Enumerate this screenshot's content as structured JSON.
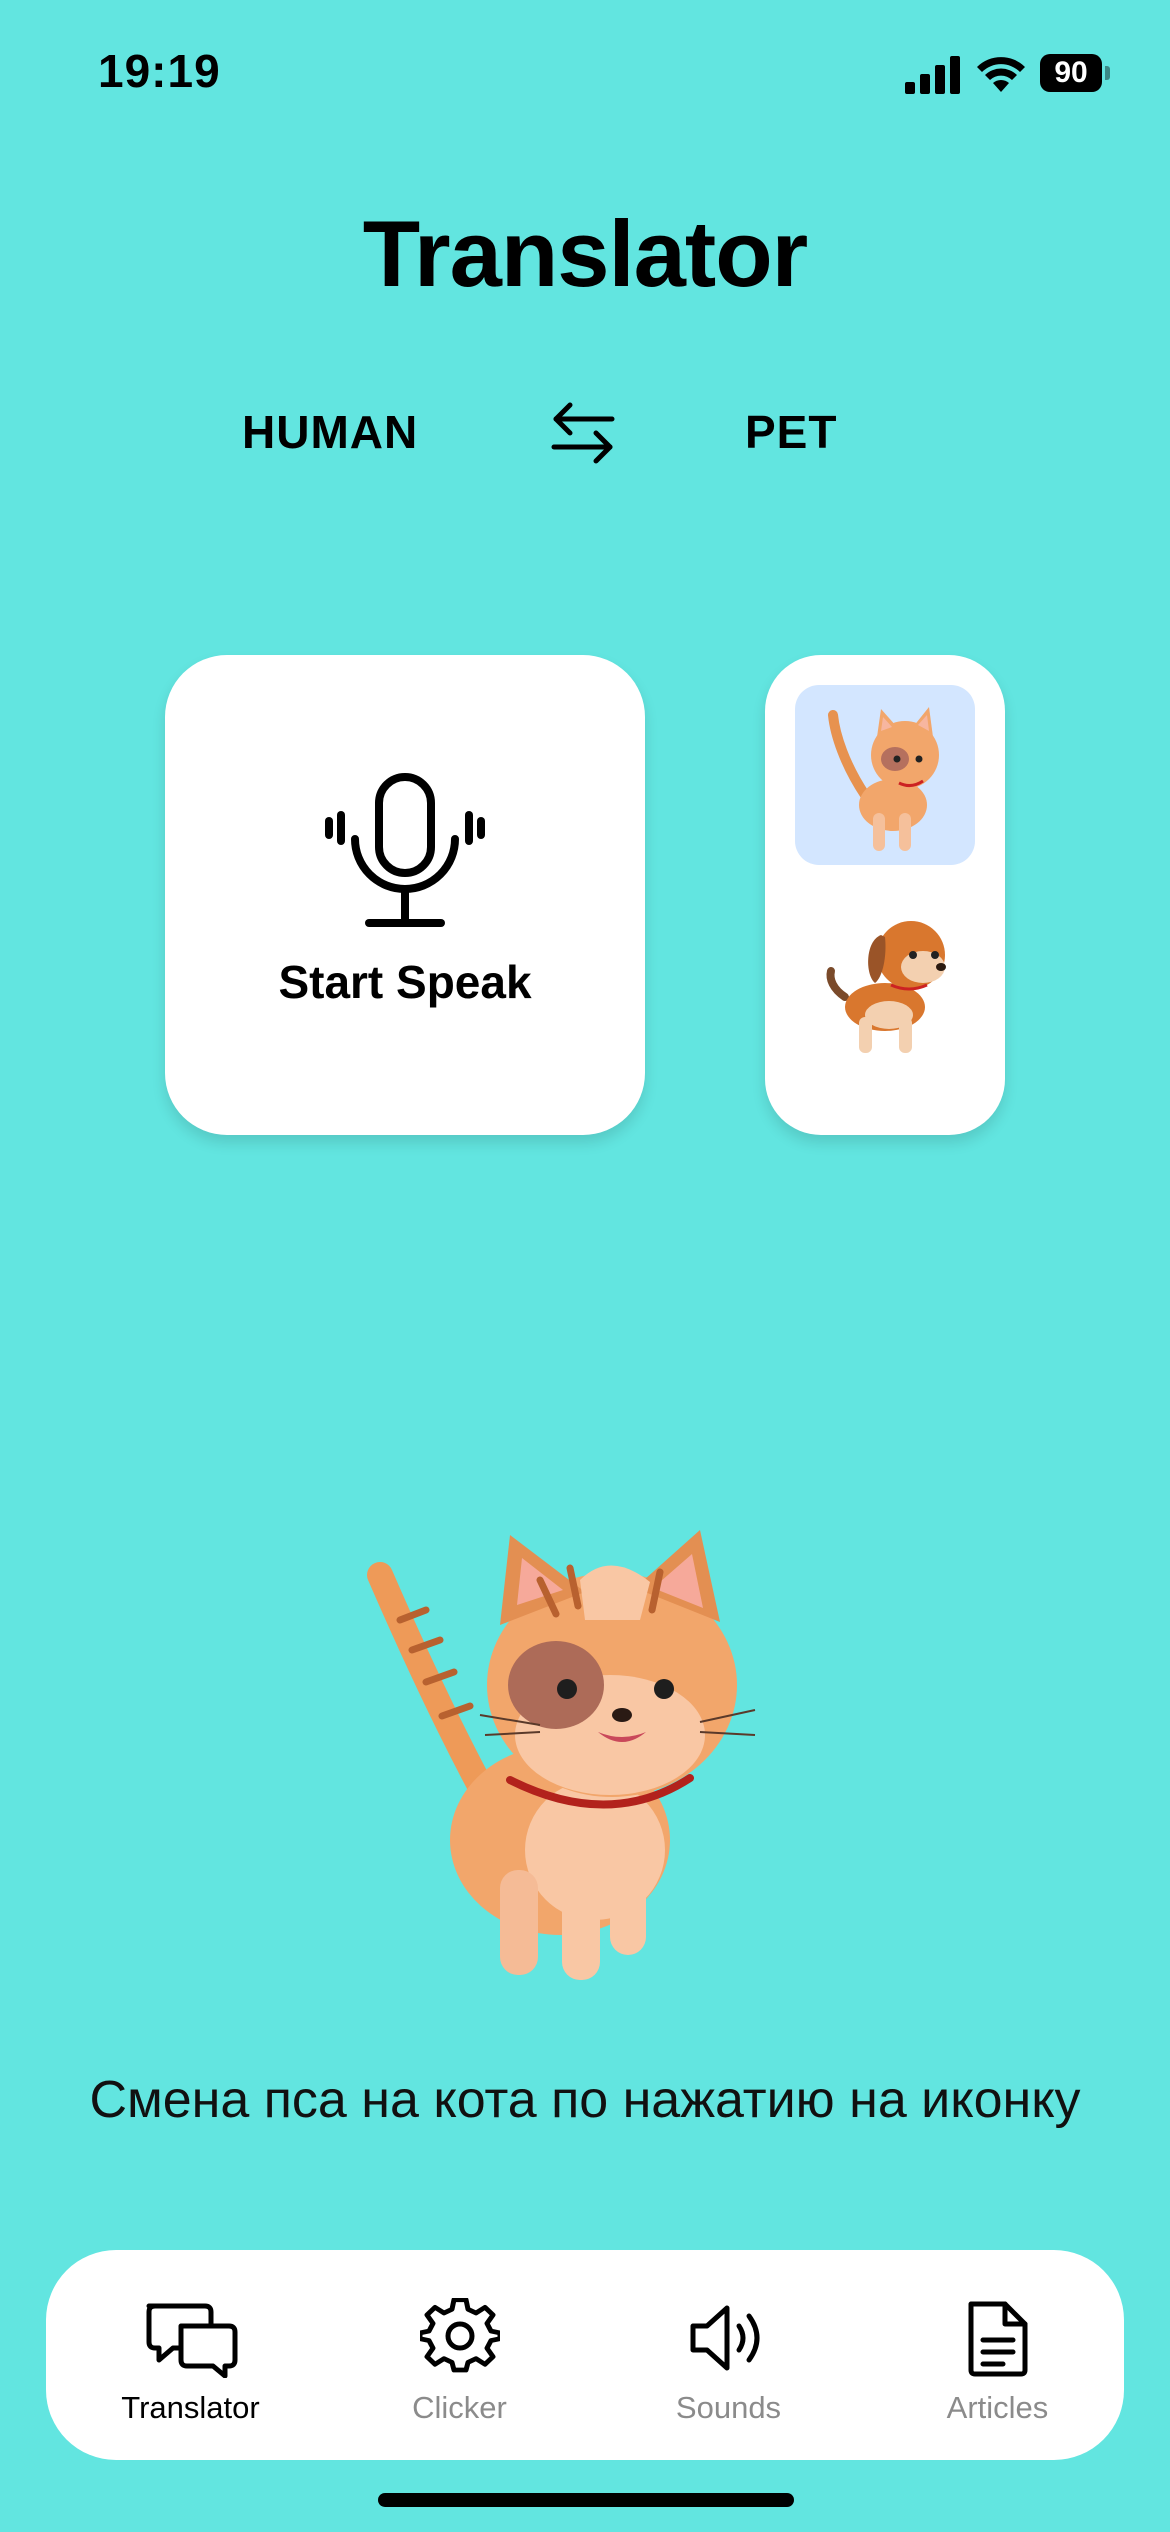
{
  "status_bar": {
    "time": "19:19",
    "battery": "90"
  },
  "title": "Translator",
  "languages": {
    "from": "HUMAN",
    "to": "PET",
    "swap_icon": "swap-arrows-icon"
  },
  "speak": {
    "label": "Start Speak",
    "icon": "microphone-icon"
  },
  "pets": {
    "selected": "cat",
    "options": [
      "cat",
      "dog"
    ]
  },
  "hint": "Смена пса на кота по нажатию на иконку",
  "tabs": [
    {
      "label": "Translator",
      "icon": "chat-bubbles-icon",
      "active": true
    },
    {
      "label": "Clicker",
      "icon": "gear-icon",
      "active": false
    },
    {
      "label": "Sounds",
      "icon": "speaker-icon",
      "active": false
    },
    {
      "label": "Articles",
      "icon": "document-icon",
      "active": false
    }
  ],
  "colors": {
    "background": "#62e5e0",
    "card": "#ffffff",
    "selected_pet_bg": "#d3e6ff",
    "inactive_tab": "#8b8b8b"
  }
}
